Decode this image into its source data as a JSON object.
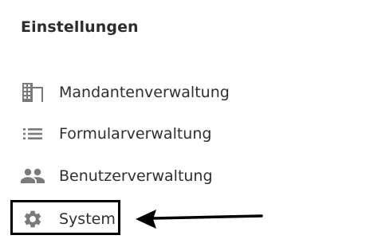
{
  "section": {
    "title": "Einstellungen"
  },
  "nav": {
    "items": [
      {
        "label": "Mandantenverwaltung",
        "icon": "building-icon"
      },
      {
        "label": "Formularverwaltung",
        "icon": "list-icon"
      },
      {
        "label": "Benutzerverwaltung",
        "icon": "people-icon"
      },
      {
        "label": "System",
        "icon": "gear-icon",
        "highlighted": true
      }
    ]
  },
  "colors": {
    "icon": "#7a7a7a",
    "text": "#2f2f2f",
    "annotation": "#000000"
  }
}
